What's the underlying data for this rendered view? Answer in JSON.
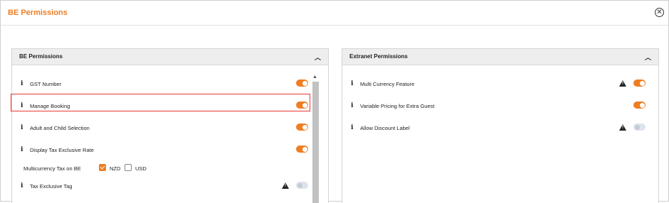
{
  "modal": {
    "title": "BE Permissions",
    "close_icon": "circle-x-icon"
  },
  "be_panel": {
    "title": "BE Permissions",
    "items": [
      {
        "label": "GST Number",
        "enabled": true
      },
      {
        "label": "Manage Booking",
        "enabled": true,
        "highlighted": true
      },
      {
        "label": "Adult and Child Selection",
        "enabled": true
      },
      {
        "label": "Display Tax Exclusive Rate",
        "enabled": true
      },
      {
        "label": "Tax Exclusive Tag",
        "enabled": false,
        "warning": true
      }
    ],
    "multicurrency": {
      "label": "Multicurrency Tax on BE",
      "options": [
        {
          "label": "NZD",
          "checked": true
        },
        {
          "label": "USD",
          "checked": false
        }
      ]
    }
  },
  "extranet_panel": {
    "title": "Extranet Permissions",
    "items": [
      {
        "label": "Multi Currency Feature",
        "enabled": true,
        "warning": true
      },
      {
        "label": "Variable Pricing for Extra Guest",
        "enabled": true
      },
      {
        "label": "Allow Discount Label",
        "enabled": false,
        "warning": true
      }
    ]
  },
  "colors": {
    "accent": "#ef7d22",
    "highlight_border": "#e53935"
  }
}
